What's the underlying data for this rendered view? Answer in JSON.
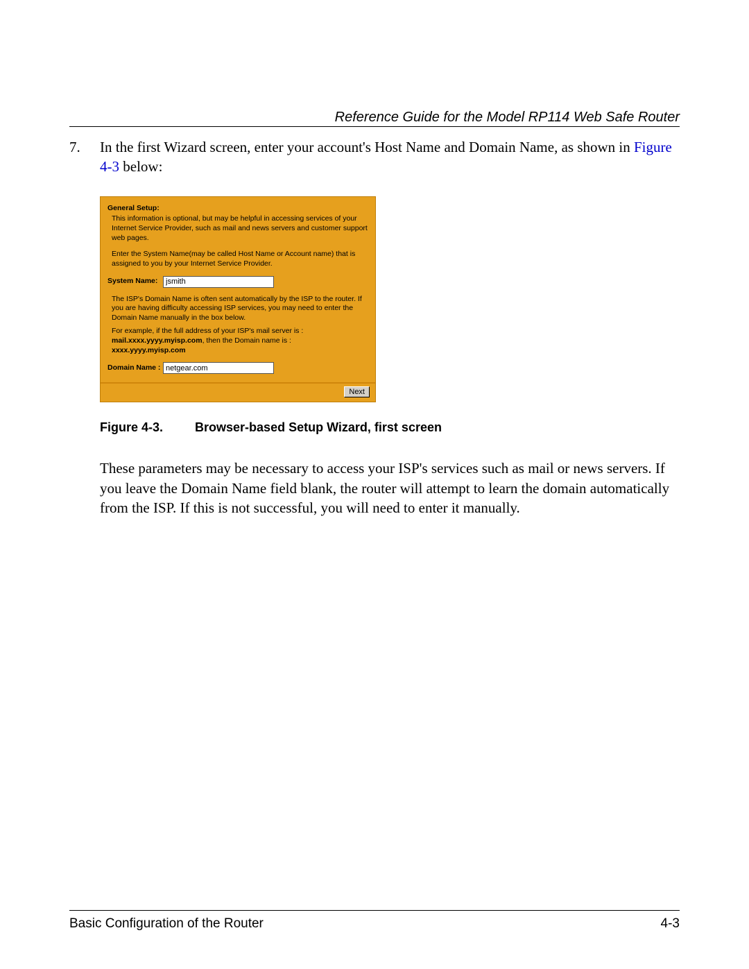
{
  "header": {
    "title": "Reference Guide for the Model RP114 Web Safe Router"
  },
  "step": {
    "number": "7.",
    "text_before": "In the first Wizard screen, enter your account's Host Name and Domain Name, as shown in ",
    "figure_ref": "Figure 4-3",
    "text_after": " below:"
  },
  "wizard": {
    "title": "General Setup:",
    "intro": "This information is optional, but may be helpful in accessing services of your Internet Service Provider, such as mail and news servers and customer support web pages.",
    "sysname_help": "Enter the System Name(may be called Host Name or Account name) that is assigned to you by your Internet Service Provider.",
    "system_name_label": "System Name:",
    "system_name_value": "jsmith",
    "domain_help": "The ISP's Domain Name is often sent automatically by the ISP to the router. If you are having difficulty accessing ISP services, you may need to enter the Domain Name manually in the box below.",
    "example_lead": "For example, if the full address of your ISP's mail server is :",
    "example_bold1": "mail.xxxx.yyyy.myisp.com",
    "example_mid": ", then the Domain name is :",
    "example_bold2": "xxxx.yyyy.myisp.com",
    "domain_name_label": "Domain Name :",
    "domain_name_value": "netgear.com",
    "next_label": "Next"
  },
  "figure_caption": {
    "label": "Figure 4-3.",
    "title": "Browser-based Setup Wizard, first screen"
  },
  "followup_text": "These parameters may be necessary to access your ISP's services such as mail or news servers. If you leave the Domain Name field blank, the router will attempt to learn the domain automatically from the ISP. If this is not successful, you will need to enter it manually.",
  "footer": {
    "section": "Basic Configuration of the Router",
    "page": "4-3"
  }
}
